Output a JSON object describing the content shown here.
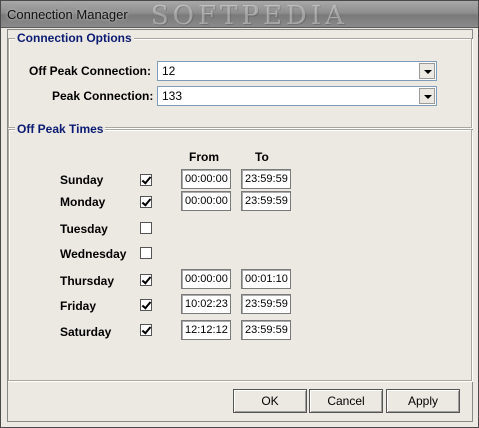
{
  "window": {
    "title": "Connection Manager",
    "watermark": "SOFTPEDIA"
  },
  "connection_options": {
    "group_label": "Connection Options",
    "off_peak_label": "Off Peak Connection:",
    "off_peak_value": "12",
    "peak_label": "Peak Connection:",
    "peak_value": "133"
  },
  "off_peak_times": {
    "group_label": "Off Peak Times",
    "col_from": "From",
    "col_to": "To",
    "days": [
      {
        "name": "Sunday",
        "checked": true,
        "from": "00:00:00",
        "to": "23:59:59"
      },
      {
        "name": "Monday",
        "checked": true,
        "from": "00:00:00",
        "to": "23:59:59"
      },
      {
        "name": "Tuesday",
        "checked": false,
        "from": "",
        "to": ""
      },
      {
        "name": "Wednesday",
        "checked": false,
        "from": "",
        "to": ""
      },
      {
        "name": "Thursday",
        "checked": true,
        "from": "00:00:00",
        "to": "00:01:10"
      },
      {
        "name": "Friday",
        "checked": true,
        "from": "10:02:23",
        "to": "23:59:59"
      },
      {
        "name": "Saturday",
        "checked": true,
        "from": "12:12:12",
        "to": "23:59:59"
      }
    ]
  },
  "buttons": {
    "ok": "OK",
    "cancel": "Cancel",
    "apply": "Apply"
  }
}
